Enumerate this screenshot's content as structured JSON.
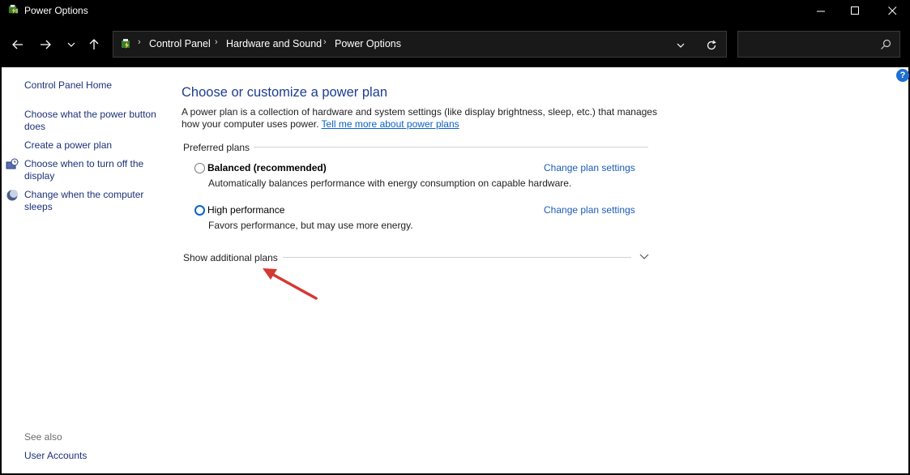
{
  "window": {
    "title": "Power Options"
  },
  "address": {
    "crumbs": [
      "Control Panel",
      "Hardware and Sound",
      "Power Options"
    ],
    "search_placeholder": ""
  },
  "left_pane": {
    "home": "Control Panel Home",
    "links": [
      "Choose what the power button does",
      "Create a power plan",
      "Choose when to turn off the display",
      "Change when the computer sleeps"
    ],
    "see_also_label": "See also",
    "see_also_links": [
      "User Accounts"
    ]
  },
  "main": {
    "title": "Choose or customize a power plan",
    "description": "A power plan is a collection of hardware and system settings (like display brightness, sleep, etc.) that manages how your computer uses power.",
    "description_link": "Tell me more about power plans",
    "section_label": "Preferred plans",
    "plans": [
      {
        "name": "Balanced (recommended)",
        "description": "Automatically balances performance with energy consumption on capable hardware.",
        "selected": false,
        "change_link": "Change plan settings"
      },
      {
        "name": "High performance",
        "description": "Favors performance, but may use more energy.",
        "selected": true,
        "change_link": "Change plan settings"
      }
    ],
    "additional_plans_label": "Show additional plans"
  },
  "colors": {
    "accent": "#0a64c8",
    "link": "#1c5cb8",
    "title": "#1e3d8f",
    "annotation_arrow": "#d33a32"
  }
}
